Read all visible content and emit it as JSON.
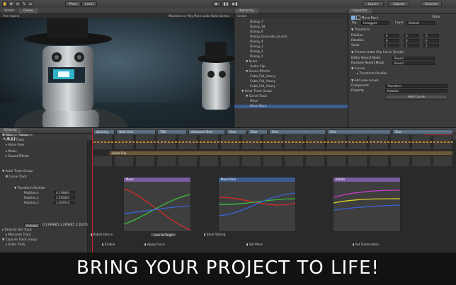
{
  "toolbar": {
    "pivot_label": "Pivot",
    "local_label": "Local",
    "layers_label": "Layers",
    "layout_label": "Layout",
    "account_label": "Account"
  },
  "scene_panel": {
    "tab_scene": "Scene",
    "tab_game": "Game",
    "aspect_label": "Free Aspect",
    "maximize_label": "Maximize on Play  Mute audio  Stats  Gizmos"
  },
  "hierarchy": {
    "tab_label": "Hierarchy",
    "create_label": "Create",
    "items": [
      "Dialog_7",
      "Dialog_18",
      "Dialog_6",
      "Dialog_favourite_sounds",
      "Dialog_4",
      "Dialog_3",
      "Dialog_2",
      "Dialog_1",
      "Music",
      "Audio Clip",
      "Sound Effects",
      "Cube_Fall_Heavy",
      "Cube_Fall_Heavy",
      "Cube_Fall_Heavy",
      "Actor Track Group",
      "Curve Track",
      "Move",
      "Move Back"
    ]
  },
  "inspector": {
    "tab_label": "Inspector",
    "object_name": "Move Back",
    "static_label": "Static",
    "tag_label": "Tag",
    "tag_value": "Untagged",
    "layer_label": "Layer",
    "layer_value": "Default",
    "transform_title": "Transform",
    "position_label": "Position",
    "rotation_label": "Rotation",
    "scale_label": "Scale",
    "pos": [
      "0",
      "0",
      "0"
    ],
    "rot": [
      "0",
      "0",
      "0"
    ],
    "scl": [
      "1",
      "1",
      "1"
    ],
    "component_title": "Cinema Actor Clip Curve (Script)",
    "editor_revert_label": "Editor Revert Mode",
    "editor_revert_value": "Revert",
    "runtime_revert_label": "Runtime Revert Mode",
    "runtime_revert_value": "Revert",
    "curves_label": "Curves",
    "curve_item": "Transform.Position",
    "add_new_curves": "Add new curves",
    "component_label": "Component",
    "component_value": "Transform",
    "property_label": "Property",
    "property_value": "Rotation",
    "add_curve_button": "Add Curve"
  },
  "director": {
    "tab_label": "Director",
    "create_label": "Create",
    "cutscene_label": "Cutscene",
    "tracks": [
      "Director Group",
      "Shot Track",
      "Voice Over",
      "Music",
      "Sound Effects",
      "Actor Track Group",
      "Curve Track",
      "Transform.Position",
      "Position.x",
      "Position.y",
      "Position.z",
      "Director Bot Track",
      "Mecanim Track",
      "Capsule Track Group",
      "Actor Track"
    ],
    "pos_values": [
      "0.119883",
      "3.295865",
      "3.000916"
    ],
    "anim_button": "Animate",
    "anim_values": "0.1199865  3.295865  2.292719",
    "shot_clips": [
      "Opening",
      "Wide Shot",
      "TBD",
      "Awesome Shot",
      "Shot",
      "Shot",
      "Shot",
      "Shot",
      "Shot"
    ],
    "audio_clip": "Audio Clip",
    "curve_boxes": [
      "Move",
      "Move Back",
      "Rotate"
    ],
    "events_row1": [
      "Robot Dance",
      "Look At Target",
      "Start Talking"
    ],
    "events_row2": [
      "Enable",
      "Apply Force",
      "Set Mass",
      "Set Destination"
    ]
  },
  "banner": {
    "text": "BRING YOUR PROJECT TO LIFE!"
  }
}
